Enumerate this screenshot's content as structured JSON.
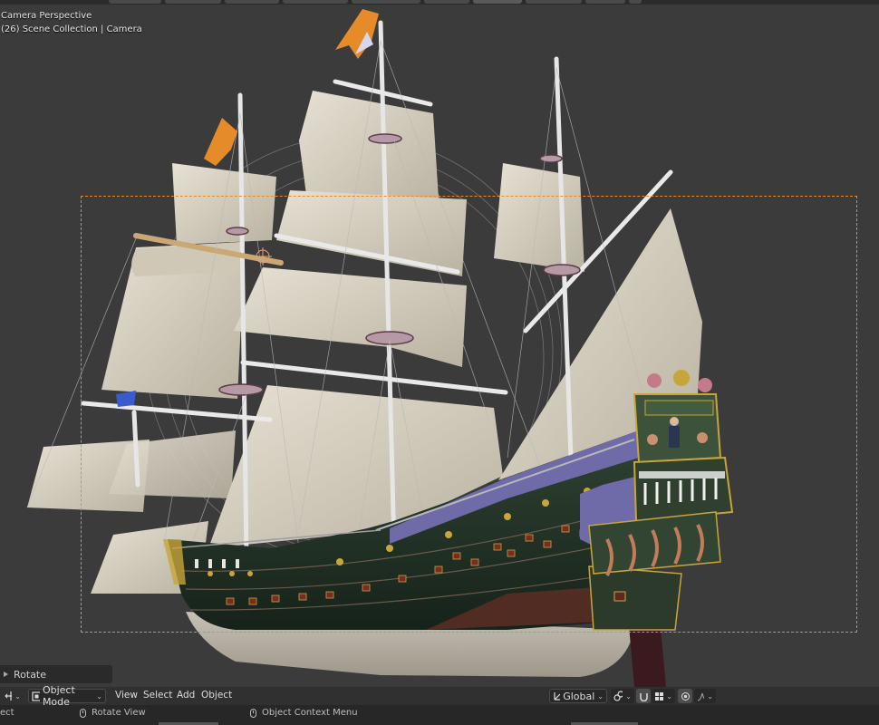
{
  "viewport": {
    "line1": "Camera Perspective",
    "line2": "(26) Scene Collection | Camera"
  },
  "operator_panel": {
    "label": "Rotate"
  },
  "header": {
    "mode": "Object Mode",
    "menus": [
      "View",
      "Select",
      "Add",
      "Object"
    ],
    "transform_orientation": "Global"
  },
  "statusbar": {
    "left": "ect",
    "middle": "Rotate View",
    "right": "Object Context Menu"
  },
  "colors": {
    "camera_frame": "#e38b2d",
    "viewport_bg": "#3b3b3b",
    "sail": "#d8d2c2",
    "hull_green": "#243528",
    "hull_purple": "#6f6aa8",
    "gold": "#c7a53a"
  },
  "icons": [
    "transform-tool-icon",
    "object-mode-icon",
    "global-axes-icon",
    "link-icon",
    "snap-icon",
    "grid-snap-icon",
    "proportional-icon",
    "falloff-icon",
    "mouse-icon"
  ]
}
